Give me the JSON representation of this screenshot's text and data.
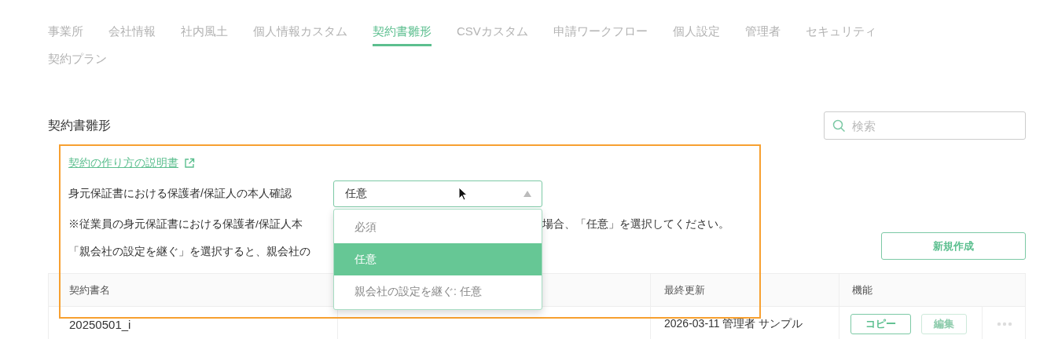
{
  "tabs": [
    {
      "label": "事業所",
      "selected": false
    },
    {
      "label": "会社情報",
      "selected": false
    },
    {
      "label": "社内風土",
      "selected": false
    },
    {
      "label": "個人情報カスタム",
      "selected": false
    },
    {
      "label": "契約書雛形",
      "selected": true
    },
    {
      "label": "CSVカスタム",
      "selected": false
    },
    {
      "label": "申請ワークフロー",
      "selected": false
    },
    {
      "label": "個人設定",
      "selected": false
    },
    {
      "label": "管理者",
      "selected": false
    },
    {
      "label": "セキュリティ",
      "selected": false
    },
    {
      "label": "契約プラン",
      "selected": false
    }
  ],
  "page_title": "契約書雛形",
  "search": {
    "placeholder": "検索"
  },
  "help_link": "契約の作り方の説明書",
  "setting": {
    "label": "身元保証書における保護者/保証人の本人確認",
    "value": "任意",
    "expanded": true,
    "options": [
      {
        "label": "必須",
        "selected": false
      },
      {
        "label": "任意",
        "selected": true
      },
      {
        "label": "親会社の設定を継ぐ: 任意",
        "selected": false
      }
    ]
  },
  "notes": [
    {
      "parts": [
        "※従業員の身元保証書における保護者/保証人本",
        "場合、「任意」を選択してください。"
      ]
    },
    {
      "parts": [
        "「親会社の設定を継ぐ」を選択すると、親会社の"
      ]
    }
  ],
  "new_button": "新規作成",
  "table": {
    "columns": [
      "契約書名",
      "最終更新",
      "機能"
    ],
    "rows": [
      {
        "name": "20250501_i",
        "updated": "2026-03-11 管理者 サンプル",
        "actions": [
          {
            "label": "コピー",
            "disabled": false
          },
          {
            "label": "編集",
            "disabled": true
          }
        ]
      }
    ]
  }
}
